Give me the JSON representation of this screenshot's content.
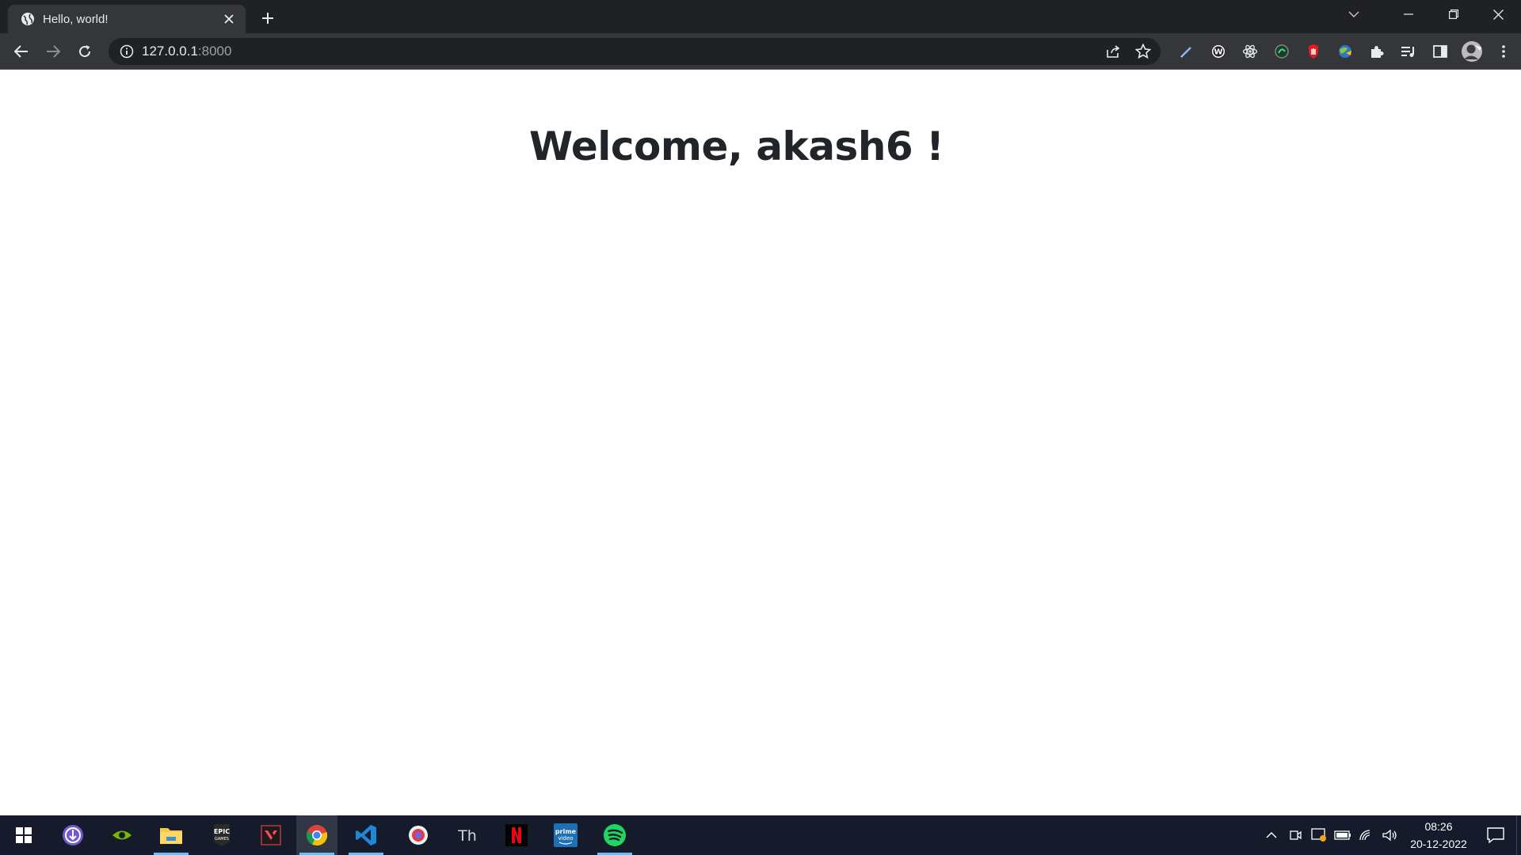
{
  "browser": {
    "tab": {
      "title": "Hello, world!",
      "favicon": "globe-icon"
    },
    "address": {
      "host": "127.0.0.1",
      "port": ":8000"
    },
    "extensions": [
      "pen-extension-icon",
      "w-extension-icon",
      "react-devtools-icon",
      "green-circle-extension-icon",
      "red-hand-extension-icon",
      "globe-colorful-extension-icon",
      "puzzle-extensions-icon",
      "media-queue-icon",
      "side-panel-icon",
      "profile-avatar-icon",
      "kebab-menu-icon"
    ]
  },
  "page": {
    "welcome": "Welcome, akash6 !"
  },
  "taskbar": {
    "apps": [
      "windows-start-icon",
      "torrent-app-icon",
      "nvidia-app-icon",
      "file-explorer-icon",
      "epic-games-icon",
      "valorant-icon",
      "chrome-icon",
      "vscode-icon",
      "screenshot-app-icon",
      "typora-app-icon",
      "netflix-icon",
      "prime-video-icon",
      "spotify-icon"
    ],
    "clock": {
      "time": "08:26",
      "date": "20-12-2022"
    }
  },
  "colors": {
    "chrome_dark": "#202124",
    "toolbar": "#35363a",
    "heading": "#212529",
    "taskbar": "#161b2b",
    "active_underline": "#76b9ed"
  }
}
